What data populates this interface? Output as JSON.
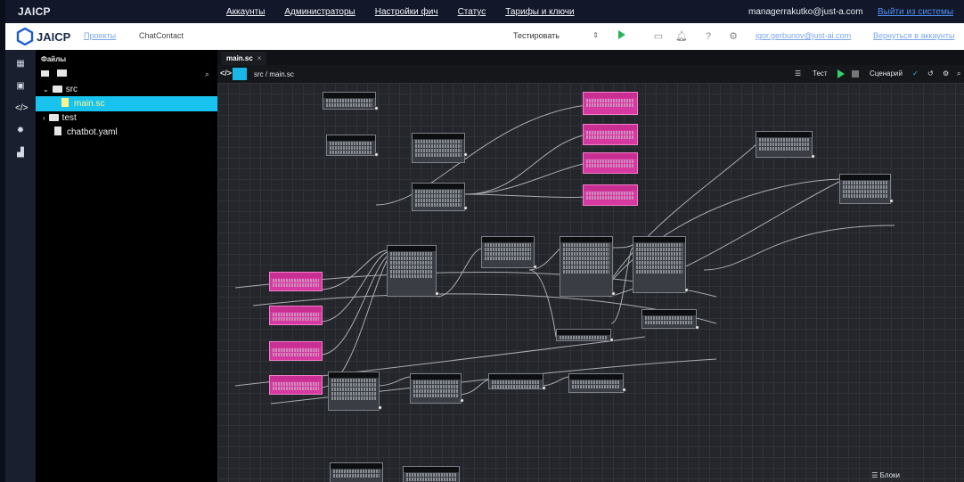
{
  "admin_bar": {
    "brand": "JAICP",
    "nav": [
      "Аккаунты",
      "Администраторы",
      "Настройки фич",
      "Статус",
      "Тарифы и ключи"
    ],
    "user_email": "managerrakutko@just-a.com",
    "logout": "Выйти из системы"
  },
  "project_bar": {
    "logo_text": "JAICP",
    "projects_link": "Проекты",
    "project_name": "ChatContact",
    "test_select": "Тестировать",
    "account_email": "igor.gerbunov@just-ai.com",
    "back_link": "Вернуться в аккаунты"
  },
  "rail": {
    "icons": [
      "table-icon",
      "chat-icon",
      "code-icon",
      "settings-icon",
      "chart-icon"
    ]
  },
  "files": {
    "title": "Файлы",
    "tree": [
      {
        "label": "src",
        "type": "folder",
        "expanded": true
      },
      {
        "label": "main.sc",
        "type": "file",
        "selected": true
      },
      {
        "label": "test",
        "type": "folder",
        "expanded": false
      },
      {
        "label": "chatbot.yaml",
        "type": "file"
      }
    ]
  },
  "editor": {
    "tab": "main.sc",
    "path": "src / main.sc",
    "toolbar": {
      "test": "Тест",
      "scenario": "Сценарий"
    },
    "blocks": "Блоки"
  },
  "colors": {
    "accent": "#19c3ef",
    "pink_node": "#d6399f",
    "canvas_bg": "#24262b",
    "play_green": "#2fd36a"
  }
}
